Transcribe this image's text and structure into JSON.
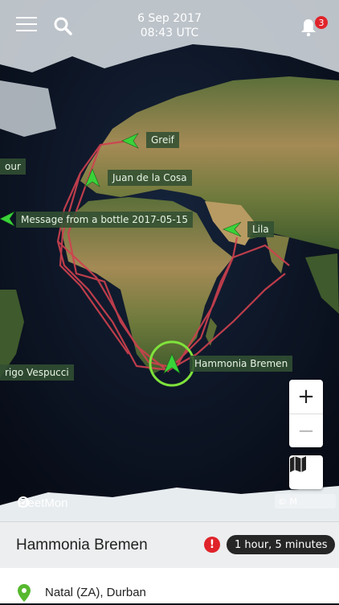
{
  "header": {
    "date": "6 Sep 2017",
    "time": "08:43 UTC",
    "notification_count": "3"
  },
  "vessels": [
    {
      "name": "Greif"
    },
    {
      "name": "Juan de la Cosa"
    },
    {
      "name": "Message from a bottle 2017-05-15"
    },
    {
      "name": "Lila"
    },
    {
      "name": "Hammonia Bremen"
    },
    {
      "name": "our"
    },
    {
      "name": "rigo Vespucci"
    }
  ],
  "map_controls": {
    "zoom_in": "+",
    "zoom_out": "−"
  },
  "brand": {
    "logo": "FleetMon",
    "copyright": "© M"
  },
  "selected_ship": {
    "name": "Hammonia Bremen",
    "alert_symbol": "!",
    "eta": "1 hour, 5 minutes",
    "destination": "Natal (ZA), Durban"
  },
  "colors": {
    "route": "#d0414f",
    "vessel_arrow": "#39d339",
    "selection_ring": "#7fe23b",
    "alert": "#e0232a"
  }
}
